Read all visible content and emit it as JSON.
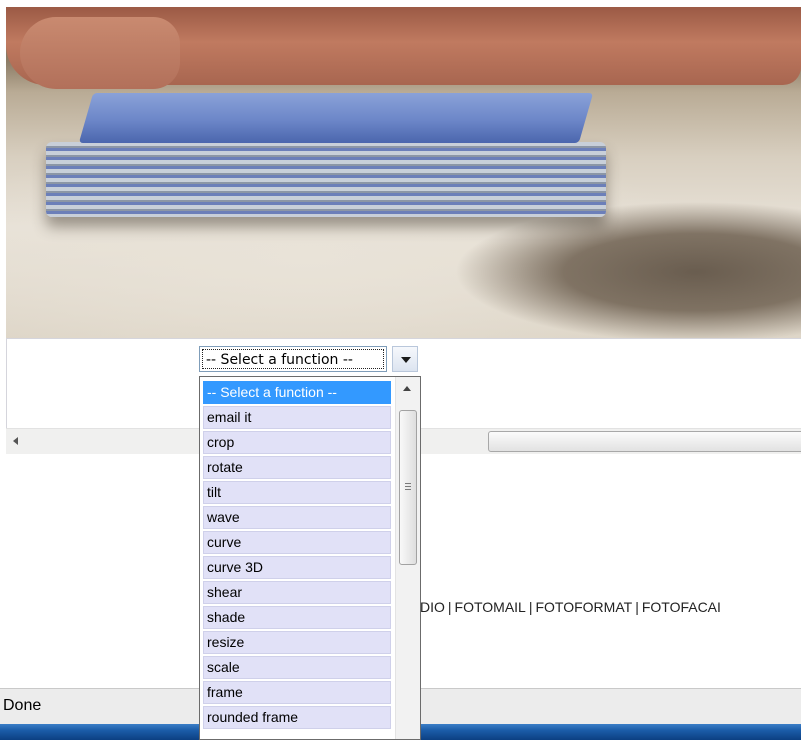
{
  "photo": {
    "description_icon": "photo-image"
  },
  "function_select": {
    "selected_label": "-- Select a function --",
    "options": [
      "-- Select a function --",
      "email it",
      "crop",
      "rotate",
      "tilt",
      "wave",
      "curve",
      "curve 3D",
      "shear",
      "shade",
      "resize",
      "scale",
      "frame",
      "rounded frame"
    ],
    "highlighted_index": 0
  },
  "footer": {
    "links": [
      "DIO",
      "FOTOMAIL",
      "FOTOFORMAT",
      "FOTOFACAI"
    ],
    "separator": "|"
  },
  "status_bar": {
    "text": "Done"
  },
  "colors": {
    "highlight": "#3399ff",
    "option_bg": "#e1e1f7",
    "taskbar": "#1b5ca8"
  }
}
